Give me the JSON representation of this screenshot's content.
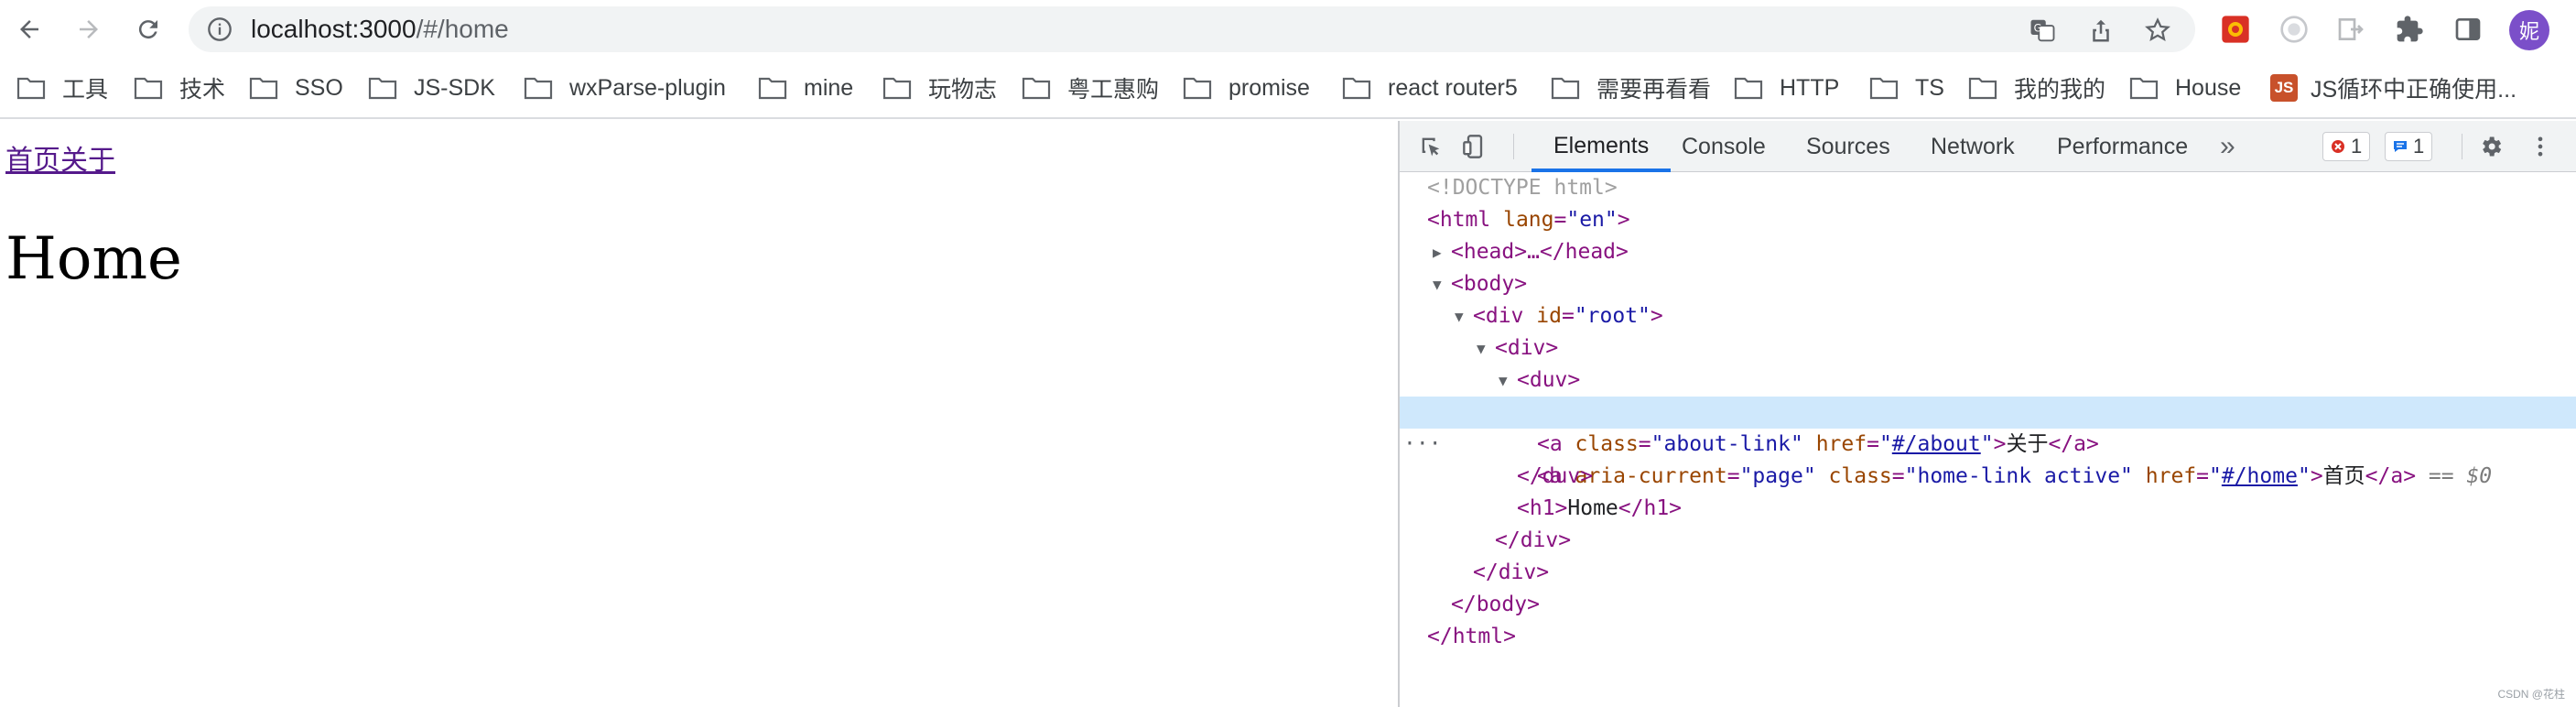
{
  "browser": {
    "url_host": "localhost:3000",
    "url_path": "/#/home",
    "profile_initial": "妮"
  },
  "bookmarks": [
    "工具",
    "技术",
    "SSO",
    "JS-SDK",
    "wxParse-plugin",
    "mine",
    "玩物志",
    "粤工惠购",
    "promise",
    "react router5",
    "需要再看看",
    "HTTP",
    "TS",
    "我的我的",
    "House",
    "JS循环中正确使用..."
  ],
  "page": {
    "home_link": "首页",
    "about_link": "关于",
    "heading": "Home"
  },
  "devtools": {
    "tabs": [
      "Elements",
      "Console",
      "Sources",
      "Network",
      "Performance"
    ],
    "more": "»",
    "errors": "1",
    "messages": "1"
  },
  "dom": {
    "doctype": "<!DOCTYPE html>",
    "html_open": "<html ",
    "lang_attr": "lang",
    "lang_val": "\"en\"",
    "close_bracket": ">",
    "head": "<head>…</head>",
    "body_open": "<body>",
    "div_root_open": "<div ",
    "id_attr": "id",
    "id_val": "\"root\"",
    "div_open": "<div>",
    "duv_open": "<duv>",
    "a_open": "<a ",
    "aria_attr": "aria-current",
    "aria_val": "\"page\"",
    "class_attr": "class",
    "class_home_val": "\"home-link active\"",
    "href_attr": "href",
    "href_home": "#/home",
    "home_text": "首页",
    "a_close": "</a>",
    "selected_marker": " == $0",
    "class_about_val": "\"about-link\"",
    "href_about": "#/about",
    "about_text": "关于",
    "duv_close": "</duv>",
    "h1_open": "<h1>",
    "h1_text": "Home",
    "h1_close": "</h1>",
    "div_close": "</div>",
    "body_close": "</body>",
    "html_close": "</html>",
    "eq": "=",
    "quote": "\"",
    "space": " ",
    "dots": "···"
  },
  "watermark": "CSDN @花柱"
}
